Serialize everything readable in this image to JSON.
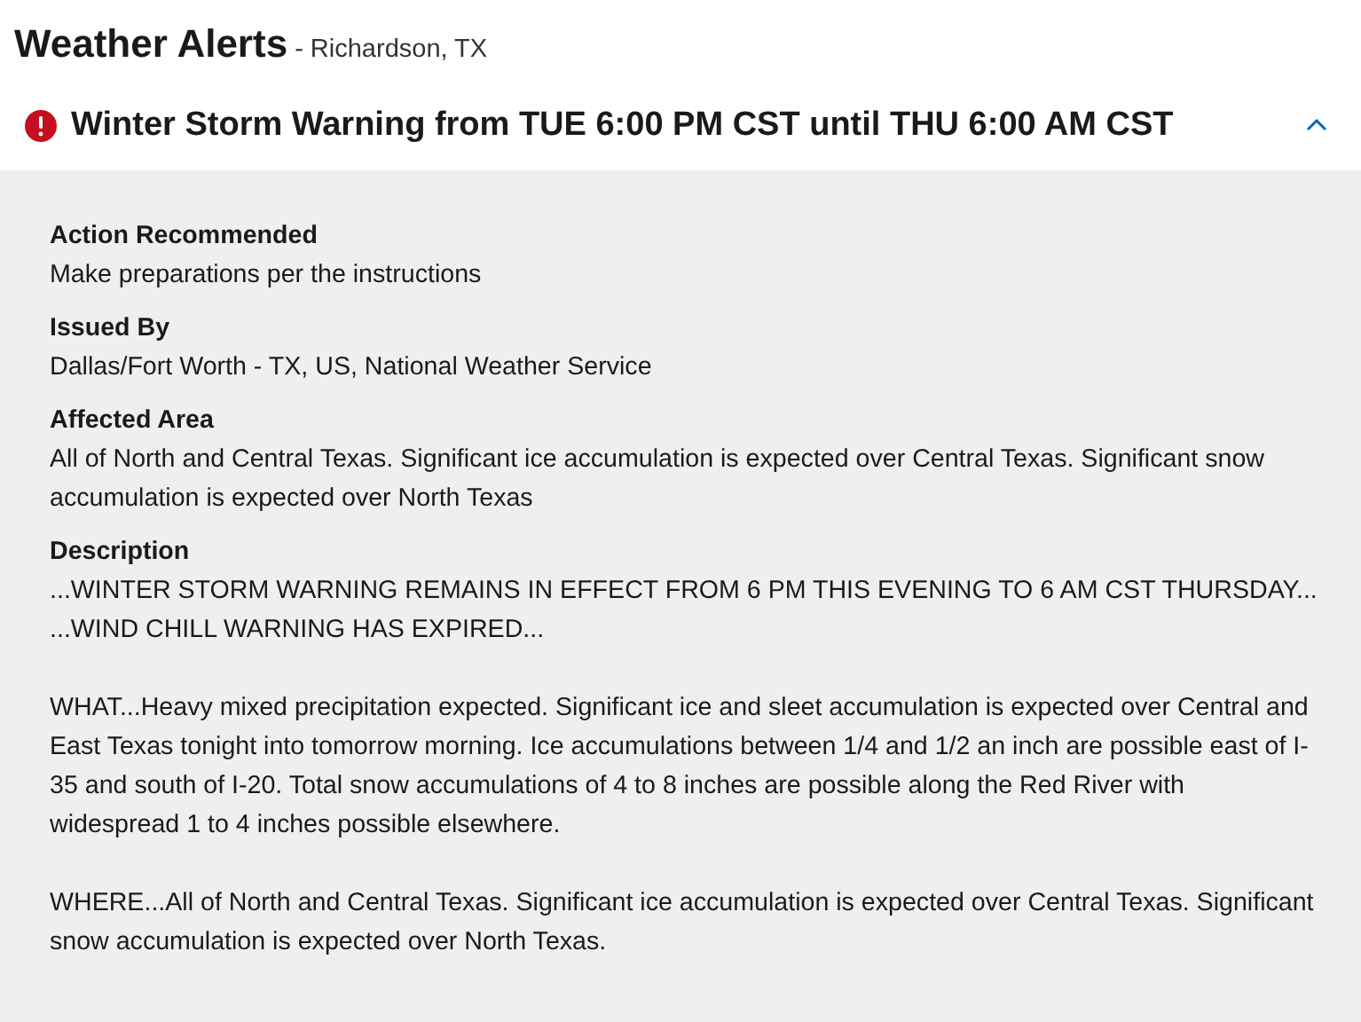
{
  "header": {
    "title": "Weather Alerts",
    "location": "- Richardson, TX"
  },
  "alert": {
    "title": "Winter Storm Warning from TUE 6:00 PM CST until THU 6:00 AM CST",
    "expanded": true,
    "sections": [
      {
        "label": "Action Recommended",
        "paragraphs": [
          "Make preparations per the instructions"
        ]
      },
      {
        "label": "Issued By",
        "paragraphs": [
          "Dallas/Fort Worth - TX, US, National Weather Service"
        ]
      },
      {
        "label": "Affected Area",
        "paragraphs": [
          "All of North and Central Texas. Significant ice accumulation is expected over Central Texas. Significant snow accumulation is expected over North Texas"
        ]
      },
      {
        "label": "Description",
        "paragraphs": [
          "...WINTER STORM WARNING REMAINS IN EFFECT FROM 6 PM THIS EVENING TO 6 AM CST THURSDAY... ...WIND CHILL WARNING HAS EXPIRED...",
          "WHAT...Heavy mixed precipitation expected. Significant ice and sleet accumulation is expected over Central and East Texas tonight into tomorrow morning. Ice accumulations between 1/4 and 1/2 an inch are possible east of I-35 and south of I-20. Total snow accumulations of 4 to 8 inches are possible along the Red River with widespread 1 to 4 inches possible elsewhere.",
          "WHERE...All of North and Central Texas. Significant ice accumulation is expected over Central Texas. Significant snow accumulation is expected over North Texas."
        ]
      }
    ]
  }
}
